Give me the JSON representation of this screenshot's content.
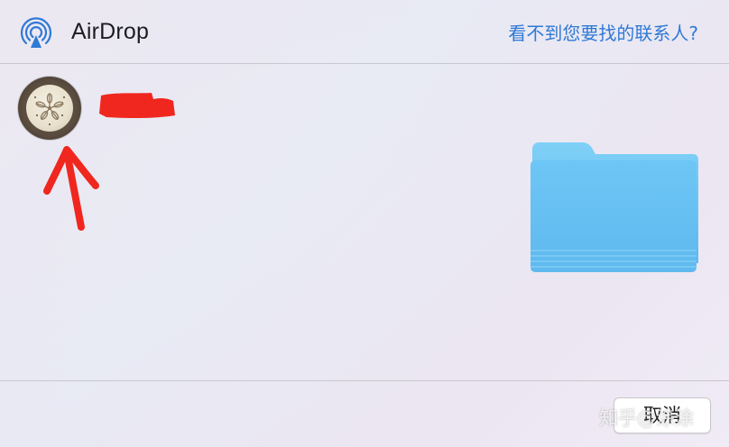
{
  "header": {
    "title": "AirDrop",
    "help_link": "看不到您要找的联系人?",
    "icon": "airdrop-icon"
  },
  "contacts": [
    {
      "avatar_icon": "sand-dollar-avatar-icon",
      "name_redacted": true
    }
  ],
  "share_item": {
    "icon": "folder-icon"
  },
  "footer": {
    "cancel_label": "取消"
  },
  "watermark": "知乎@涂涂",
  "colors": {
    "accent": "#2f79d6",
    "folder": "#6ec8f7",
    "annotation": "#f0271f"
  }
}
